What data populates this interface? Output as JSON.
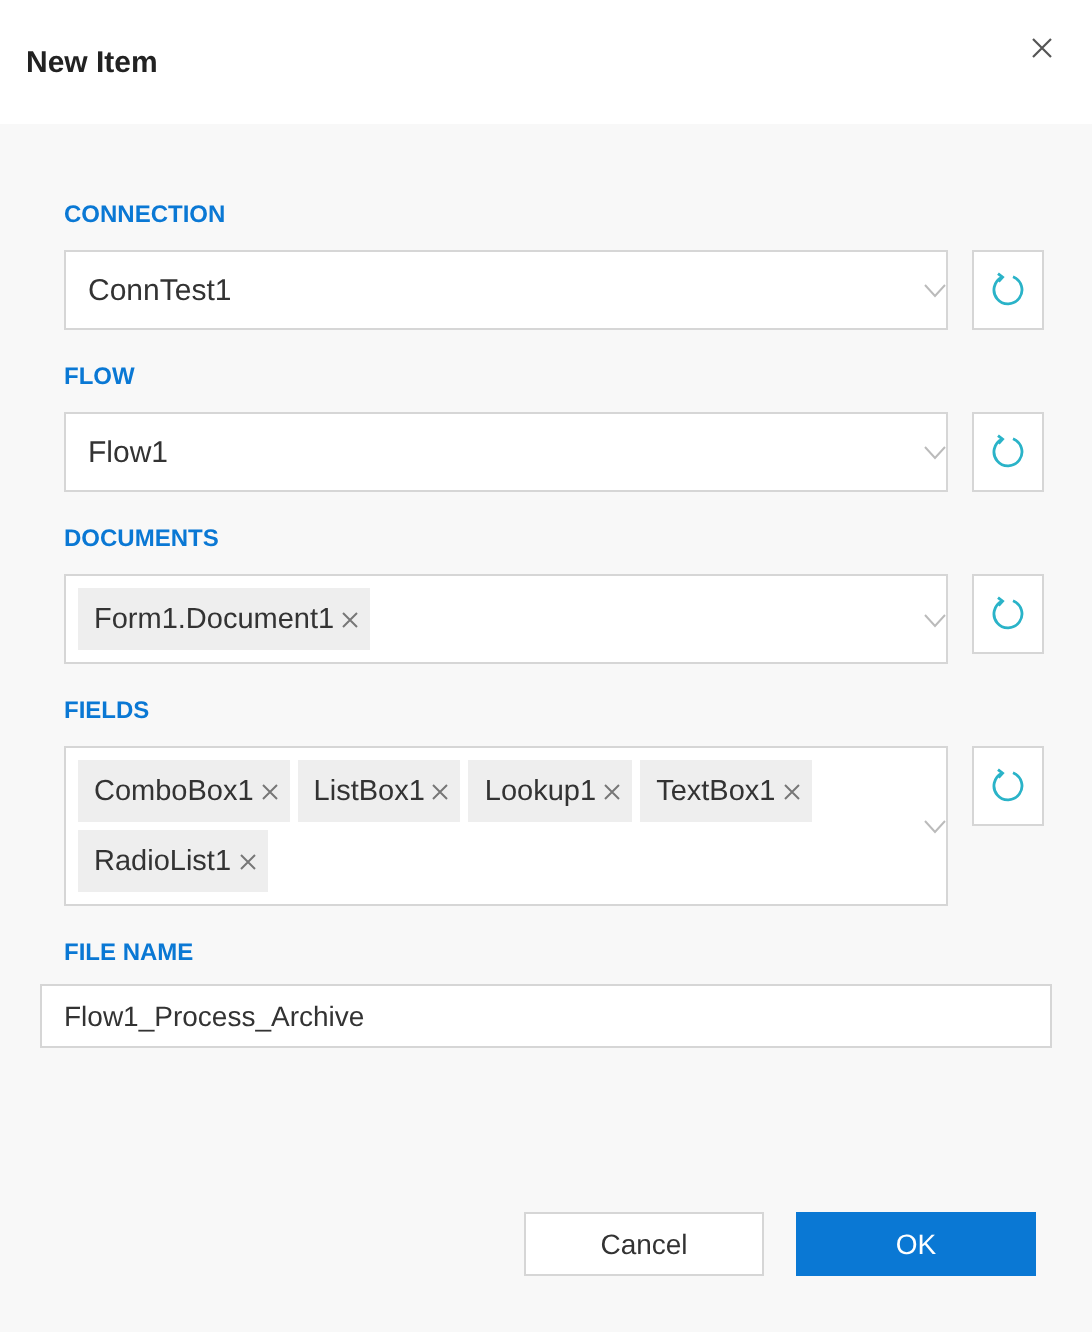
{
  "dialog": {
    "title": "New Item"
  },
  "fields": [
    {
      "label": "CONNECTION",
      "kind": "select",
      "value": "ConnTest1"
    },
    {
      "label": "FLOW",
      "kind": "select",
      "value": "Flow1"
    },
    {
      "label": "DOCUMENTS",
      "kind": "tags",
      "tags": [
        "Form1.Document1"
      ]
    },
    {
      "label": "FIELDS",
      "kind": "tags",
      "tags": [
        "ComboBox1",
        "ListBox1",
        "Lookup1",
        "TextBox1",
        "RadioList1"
      ]
    },
    {
      "label": "FILE NAME",
      "kind": "text",
      "value": "Flow1_Process_Archive"
    }
  ],
  "buttons": [
    {
      "label": "Cancel",
      "kind": "secondary"
    },
    {
      "label": "OK",
      "kind": "primary"
    }
  ]
}
